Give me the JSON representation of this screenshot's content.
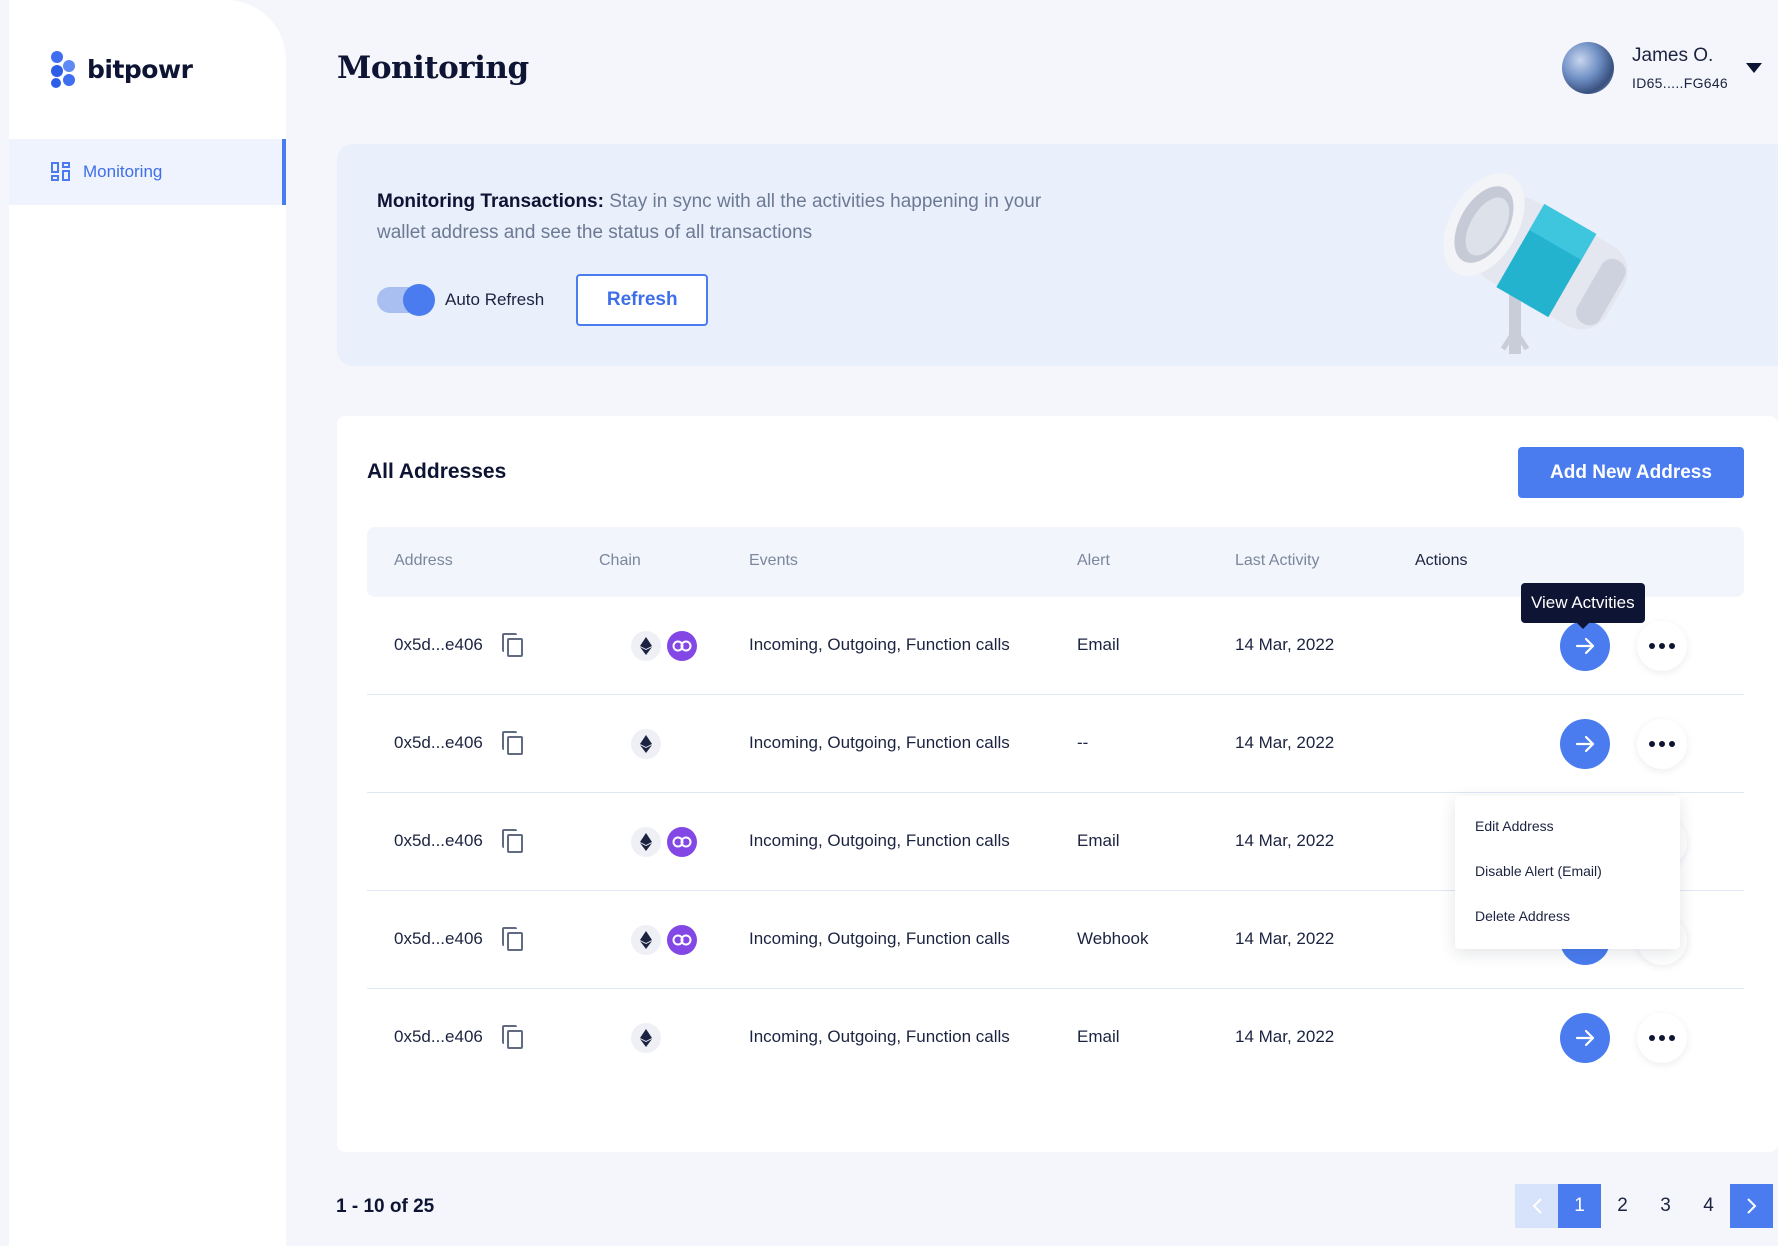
{
  "app": {
    "logo_text": "bitpowr"
  },
  "sidebar": {
    "items": [
      {
        "label": "Monitoring",
        "icon": "dashboard-icon",
        "active": true
      }
    ]
  },
  "header": {
    "title": "Monitoring",
    "user": {
      "name": "James O.",
      "id": "ID65.....FG646"
    }
  },
  "banner": {
    "heading": "Monitoring Transactions:",
    "text": " Stay in sync with all the activities happening in your wallet address and see the status of all transactions",
    "toggle_label": "Auto Refresh",
    "toggle_on": true,
    "refresh_label": "Refresh"
  },
  "table": {
    "title": "All Addresses",
    "add_label": "Add New Address",
    "columns": [
      "Address",
      "Chain",
      "Events",
      "Alert",
      "Last Activity",
      "Actions"
    ],
    "rows": [
      {
        "address": "0x5d...e406",
        "chains": [
          "ethereum",
          "polygon"
        ],
        "events": "Incoming, Outgoing, Function calls",
        "alert": "Email",
        "last_activity": "14 Mar, 2022"
      },
      {
        "address": "0x5d...e406",
        "chains": [
          "ethereum"
        ],
        "events": "Incoming, Outgoing, Function calls",
        "alert": "--",
        "last_activity": "14 Mar, 2022"
      },
      {
        "address": "0x5d...e406",
        "chains": [
          "ethereum",
          "polygon"
        ],
        "events": "Incoming, Outgoing, Function calls",
        "alert": "Email",
        "last_activity": "14 Mar, 2022"
      },
      {
        "address": "0x5d...e406",
        "chains": [
          "ethereum",
          "polygon"
        ],
        "events": "Incoming, Outgoing, Function calls",
        "alert": "Webhook",
        "last_activity": "14 Mar, 2022"
      },
      {
        "address": "0x5d...e406",
        "chains": [
          "ethereum"
        ],
        "events": "Incoming, Outgoing, Function calls",
        "alert": "Email",
        "last_activity": "14 Mar, 2022"
      }
    ]
  },
  "tooltip": {
    "label": "View Actvities"
  },
  "row_menu": {
    "items": [
      "Edit Address",
      "Disable Alert (Email)",
      "Delete Address"
    ]
  },
  "pagination": {
    "summary": "1 - 10 of 25",
    "pages": [
      "1",
      "2",
      "3",
      "4"
    ],
    "current": "1"
  },
  "colors": {
    "accent": "#4a7cf0",
    "polygon": "#8247e5",
    "text_dark": "#0e1433"
  }
}
